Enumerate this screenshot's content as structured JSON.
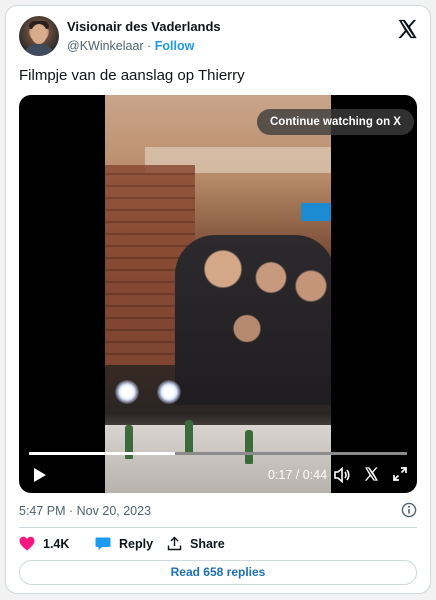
{
  "author": {
    "name": "Visionair des Vaderlands",
    "handle": "@KWinkelaar",
    "separator": "·",
    "follow_label": "Follow"
  },
  "tweet": {
    "text": "Filmpje van de aanslag op Thierry",
    "timestamp": "5:47 PM · Nov 20, 2023"
  },
  "video": {
    "continue_label": "Continue watching on X",
    "time_display": "0:17 / 0:44",
    "progress": 0.386
  },
  "actions": {
    "likes_count": "1.4K",
    "reply_label": "Reply",
    "share_label": "Share"
  },
  "read_replies_label": "Read 658 replies",
  "colors": {
    "accent": "#1d9bf0",
    "like": "#f91880",
    "muted": "#536471"
  },
  "icons": [
    "x-logo-icon",
    "play-icon",
    "volume-icon",
    "x-icon",
    "fullscreen-icon",
    "info-icon",
    "heart-icon",
    "reply-icon",
    "share-icon"
  ]
}
